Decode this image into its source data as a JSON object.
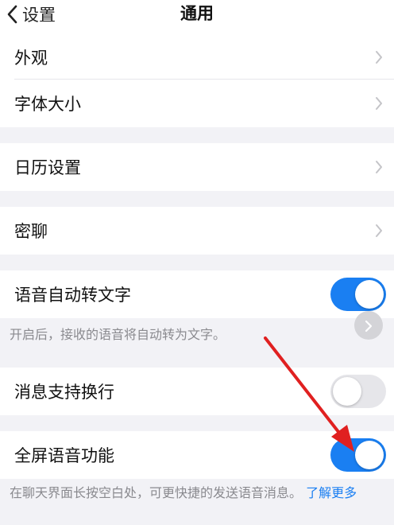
{
  "nav": {
    "back_label": "设置",
    "title": "通用"
  },
  "items": {
    "appearance": "外观",
    "font_size": "字体大小",
    "calendar": "日历设置",
    "secret_chat": "密聊",
    "voice_to_text": "语音自动转文字",
    "voice_to_text_desc": "开启后，接收的语音将自动转为文字。",
    "line_break": "消息支持换行",
    "fullscreen_voice": "全屏语音功能",
    "fullscreen_voice_desc": "在聊天界面长按空白处，可更快捷的发送语音消息。",
    "learn_more": "了解更多"
  },
  "toggles": {
    "voice_to_text": true,
    "line_break": false,
    "fullscreen_voice": true
  },
  "colors": {
    "accent": "#1a7ff2",
    "annotation_arrow": "#e02020"
  },
  "icons": {
    "back": "chevron-left-icon",
    "row_arrow": "chevron-right-icon",
    "float": "chevron-right-icon"
  }
}
